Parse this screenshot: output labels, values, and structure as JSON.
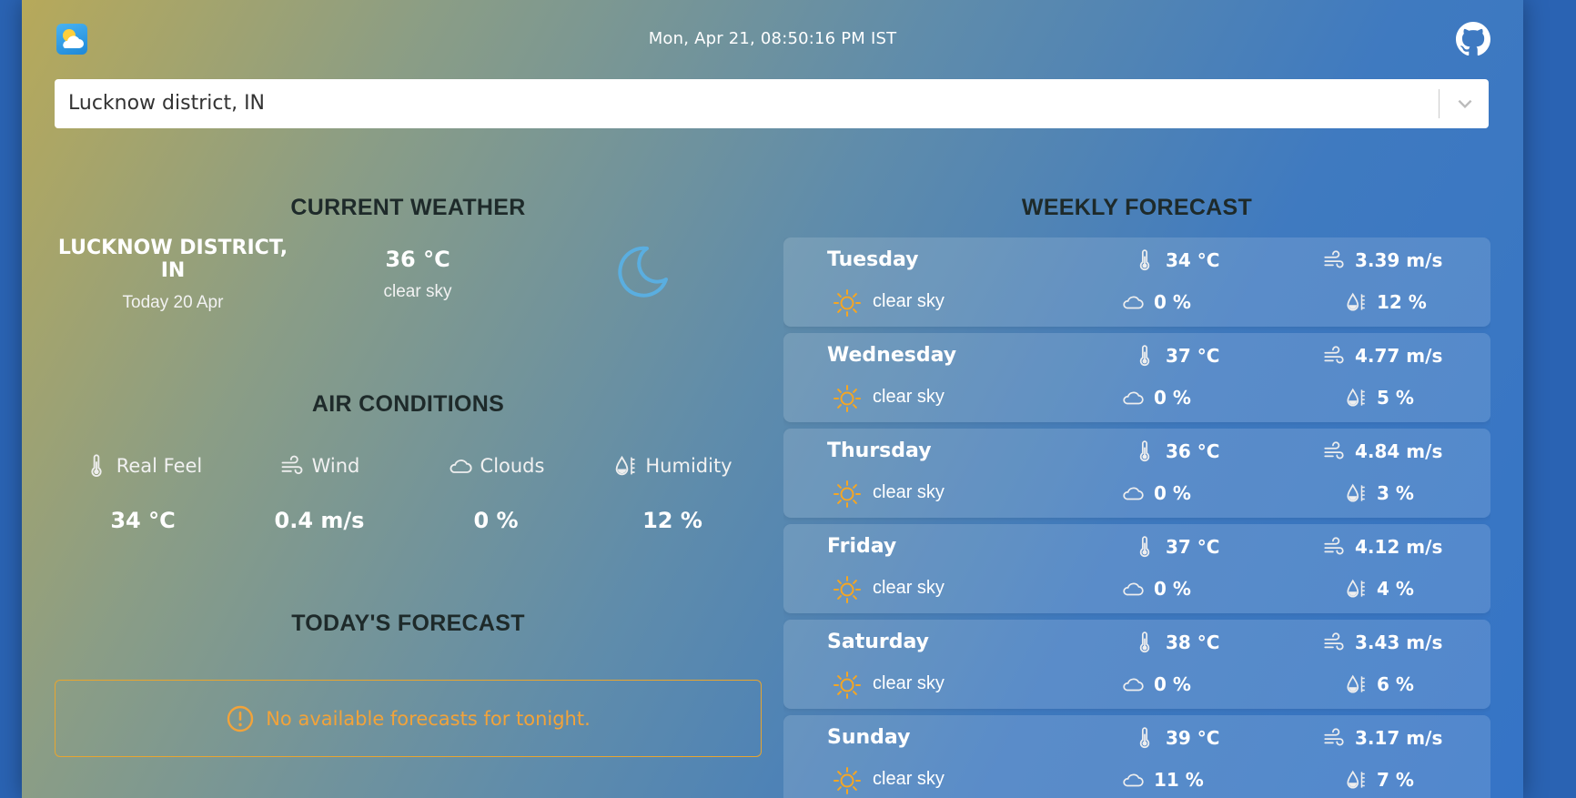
{
  "header": {
    "datetime": "Mon, Apr 21, 08:50:16 PM IST",
    "logo_icon": "partly-cloudy-logo-icon",
    "github_icon": "github-icon"
  },
  "search": {
    "value": "Lucknow district, IN",
    "dropdown_icon": "chevron-down-icon"
  },
  "current": {
    "title": "CURRENT WEATHER",
    "city": "LUCKNOW DISTRICT, IN",
    "date": "Today 20 Apr",
    "temperature": "36 °C",
    "description": "clear sky",
    "icon": "moon-icon"
  },
  "air": {
    "title": "AIR CONDITIONS",
    "items": [
      {
        "label": "Real Feel",
        "value": "34 °C",
        "icon": "thermometer-icon"
      },
      {
        "label": "Wind",
        "value": "0.4 m/s",
        "icon": "wind-icon"
      },
      {
        "label": "Clouds",
        "value": "0 %",
        "icon": "cloud-icon"
      },
      {
        "label": "Humidity",
        "value": "12 %",
        "icon": "humidity-icon"
      }
    ]
  },
  "today": {
    "title": "TODAY'S FORECAST",
    "message": "No available forecasts for tonight.",
    "icon": "alert-circle-icon"
  },
  "weekly": {
    "title": "WEEKLY FORECAST",
    "days": [
      {
        "day": "Tuesday",
        "desc": "clear sky",
        "temp": "34 °C",
        "clouds": "0 %",
        "wind": "3.39 m/s",
        "humidity": "12 %"
      },
      {
        "day": "Wednesday",
        "desc": "clear sky",
        "temp": "37 °C",
        "clouds": "0 %",
        "wind": "4.77 m/s",
        "humidity": "5 %"
      },
      {
        "day": "Thursday",
        "desc": "clear sky",
        "temp": "36 °C",
        "clouds": "0 %",
        "wind": "4.84 m/s",
        "humidity": "3 %"
      },
      {
        "day": "Friday",
        "desc": "clear sky",
        "temp": "37 °C",
        "clouds": "0 %",
        "wind": "4.12 m/s",
        "humidity": "4 %"
      },
      {
        "day": "Saturday",
        "desc": "clear sky",
        "temp": "38 °C",
        "clouds": "0 %",
        "wind": "3.43 m/s",
        "humidity": "6 %"
      },
      {
        "day": "Sunday",
        "desc": "clear sky",
        "temp": "39 °C",
        "clouds": "11 %",
        "wind": "3.17 m/s",
        "humidity": "7 %"
      }
    ]
  },
  "colors": {
    "alert": "#f2a33a",
    "sun": "#f5a623",
    "moon": "#5aaee0",
    "title": "#1e2a2a"
  }
}
